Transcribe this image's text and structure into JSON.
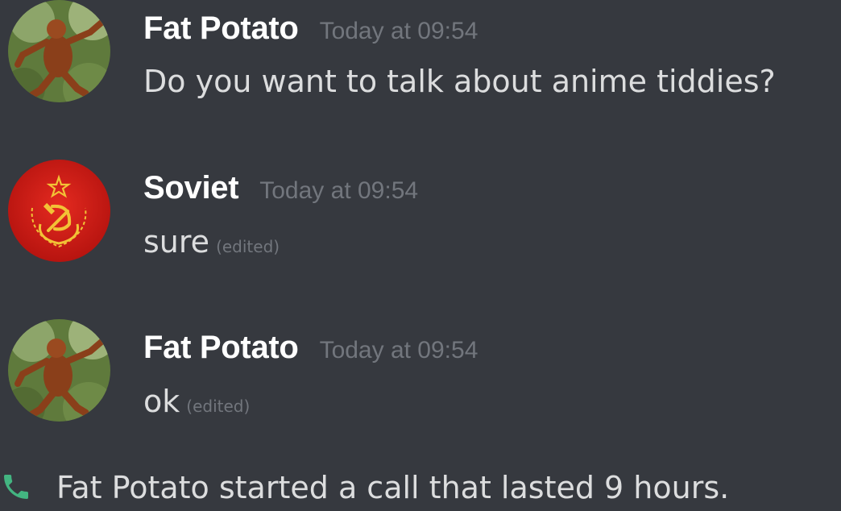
{
  "colors": {
    "background": "#36393f",
    "username": "#ffffff",
    "message_text": "#dcddde",
    "timestamp": "#72767d",
    "call_icon": "#43b581",
    "soviet_red": "#d21a14",
    "soviet_gold": "#f2c236"
  },
  "messages": [
    {
      "avatar_icon": "orangutan-avatar",
      "username": "Fat Potato",
      "timestamp": "Today at 09:54",
      "text": "Do you want to talk about anime tiddies?",
      "edited": ""
    },
    {
      "avatar_icon": "hammer-sickle-avatar",
      "username": "Soviet",
      "timestamp": "Today at 09:54",
      "text": "sure",
      "edited": "(edited)"
    },
    {
      "avatar_icon": "orangutan-avatar",
      "username": "Fat Potato",
      "timestamp": "Today at 09:54",
      "text": "ok",
      "edited": "(edited)"
    }
  ],
  "call_event": {
    "icon": "phone-icon",
    "text": "Fat Potato started a call that lasted 9 hours."
  }
}
